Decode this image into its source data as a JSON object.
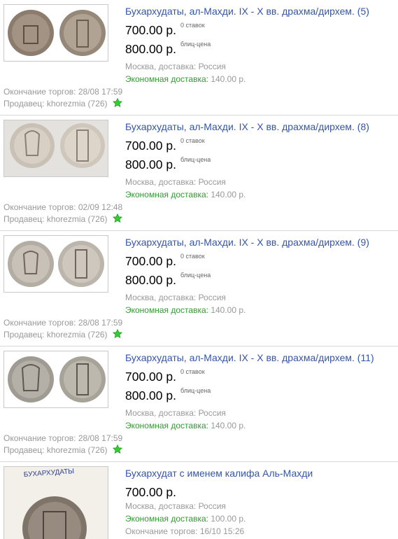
{
  "items": [
    {
      "title": "Бухархудаты, ал-Махди. IX - X вв. драхма/дирхем. (5)",
      "price": "700.00 р.",
      "bids_note": "0 ставок",
      "buyout": "800.00 р.",
      "buyout_note": "блиц-цена",
      "location": "Москва, доставка: Россия",
      "shipping_label": "Экономная доставка:",
      "shipping_value": "140.00 р.",
      "end": "Окончание торгов: 28/08 17:59",
      "seller": "Продавец: khorezmia (726)"
    },
    {
      "title": "Бухархудаты, ал-Махди. IX - X вв. драхма/дирхем. (8)",
      "price": "700.00 р.",
      "bids_note": "0 ставок",
      "buyout": "800.00 р.",
      "buyout_note": "блиц-цена",
      "location": "Москва, доставка: Россия",
      "shipping_label": "Экономная доставка:",
      "shipping_value": "140.00 р.",
      "end": "Окончание торгов: 02/09 12:48",
      "seller": "Продавец: khorezmia (726)"
    },
    {
      "title": "Бухархудаты, ал-Махди. IX - X вв. драхма/дирхем. (9)",
      "price": "700.00 р.",
      "bids_note": "0 ставок",
      "buyout": "800.00 р.",
      "buyout_note": "блиц-цена",
      "location": "Москва, доставка: Россия",
      "shipping_label": "Экономная доставка:",
      "shipping_value": "140.00 р.",
      "end": "Окончание торгов: 28/08 17:59",
      "seller": "Продавец: khorezmia (726)"
    },
    {
      "title": "Бухархудаты, ал-Махди. IX - X вв. драхма/дирхем. (11)",
      "price": "700.00 р.",
      "bids_note": "0 ставок",
      "buyout": "800.00 р.",
      "buyout_note": "блиц-цена",
      "location": "Москва, доставка: Россия",
      "shipping_label": "Экономная доставка:",
      "shipping_value": "140.00 р.",
      "end": "Окончание торгов: 28/08 17:59",
      "seller": "Продавец: khorezmia (726)"
    },
    {
      "title": "Бухархудат с именем калифа Аль-Махди",
      "price": "700.00 р.",
      "location": "Москва, доставка: Россия",
      "shipping_label": "Экономная доставка:",
      "shipping_value": "100.00 р.",
      "end": "Окончание торгов: 16/10 15:26",
      "photo_caption": "БУХАРХУДАТЫ"
    }
  ],
  "colors": {
    "link": "#3355aa",
    "shipping_label": "#339933",
    "muted": "#999999",
    "star": "#33cc33"
  },
  "icons": {
    "seller_badge": "green-star-icon"
  }
}
